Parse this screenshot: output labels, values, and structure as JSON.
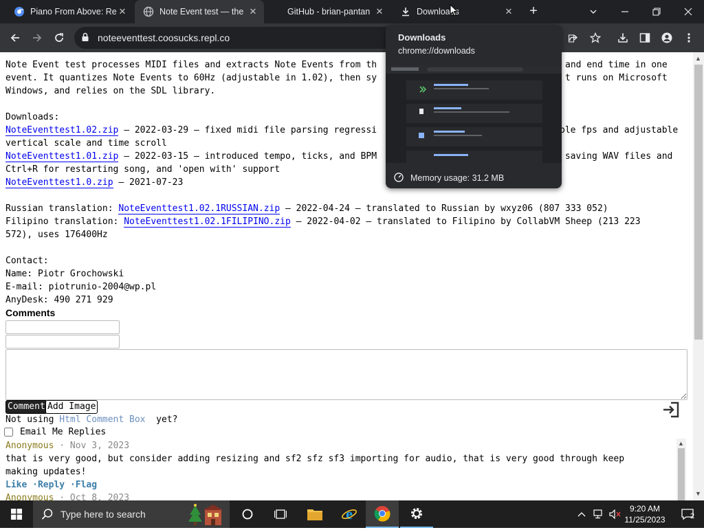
{
  "tabs": [
    {
      "title": "Piano From Above: Re",
      "favicon": "chrome-icon",
      "close": "✕"
    },
    {
      "title": "Note Event test — the",
      "favicon": "globe-icon",
      "close": "✕"
    },
    {
      "title": "GitHub - brian-pantan",
      "favicon": "none",
      "close": "✕"
    },
    {
      "title": "Downloads",
      "favicon": "download-icon",
      "close": "✕"
    }
  ],
  "toolbar": {
    "url": "noteeventtest.coosucks.repl.co"
  },
  "hover_card": {
    "title": "Downloads",
    "url": "chrome://downloads",
    "memory": "Memory usage: 31.2 MB"
  },
  "content": {
    "intro": [
      "Note Event test processes MIDI files and extracts Note Events from th",
      "event. It quantizes Note Events to 60Hz (adjustable in 1.02), then sy",
      "Windows, and relies on the SDL library."
    ],
    "intro_right": [
      "and end time in one",
      "t runs on Microsoft"
    ],
    "downloads_label": "Downloads:",
    "downloads": [
      {
        "link": "NoteEventtest1.02.zip",
        "text": " — 2022-03-29 — fixed midi file parsing regressi",
        "right": "ble fps and adjustable",
        "cont": "vertical scale and time scroll"
      },
      {
        "link": "NoteEventtest1.01.zip",
        "text": " — 2022-03-15 — introduced tempo, ticks, and BPM",
        "right": " saving WAV files and",
        "cont": "Ctrl+R for restarting song, and 'open with' support"
      },
      {
        "link": "NoteEventtest1.0.zip",
        "text": " — 2021-07-23",
        "right": "",
        "cont": ""
      }
    ],
    "russian": {
      "prefix": "Russian translation: ",
      "link": "NoteEventtest1.02.1RUSSIAN.zip",
      "suffix": " — 2022-04-24 — translated to Russian by wxyz06 (807 333 052)"
    },
    "filipino": {
      "prefix": "Filipino translation: ",
      "link": "NoteEventtest1.02.1FILIPINO.zip",
      "suffix": " — 2022-04-02 — translated to Filipino by CollabVM Sheep (213 223",
      "cont": "572), uses 176400Hz"
    },
    "contact_label": "Contact:",
    "contact_name": "Name: Piotr Grochowski",
    "contact_email": "E-mail: piotrunio-2004@wp.pl",
    "contact_anydesk": "AnyDesk: 490 271 929"
  },
  "comments": {
    "heading": "Comments",
    "comment_button": "Comment",
    "add_image_button": "Add Image",
    "not_using_prefix": "Not using ",
    "not_using_link": "Html Comment Box",
    "not_using_suffix": "  yet?",
    "email_me": "Email Me Replies",
    "entries": [
      {
        "author": "Anonymous",
        "date": " · Nov 3, 2023",
        "text1": "that is very good, but consider adding resizing and sf2 sfz sf3 importing for audio, that is very good through keep",
        "text2": "making updates!",
        "like": "Like",
        "reply": "·Reply",
        "flag": "·Flag"
      },
      {
        "author": "Anonymous",
        "date": " · Oct 8, 2023"
      }
    ]
  },
  "taskbar": {
    "search_placeholder": "Type here to search",
    "time": "9:20 AM",
    "date": "11/25/2023",
    "notifications": "2"
  }
}
